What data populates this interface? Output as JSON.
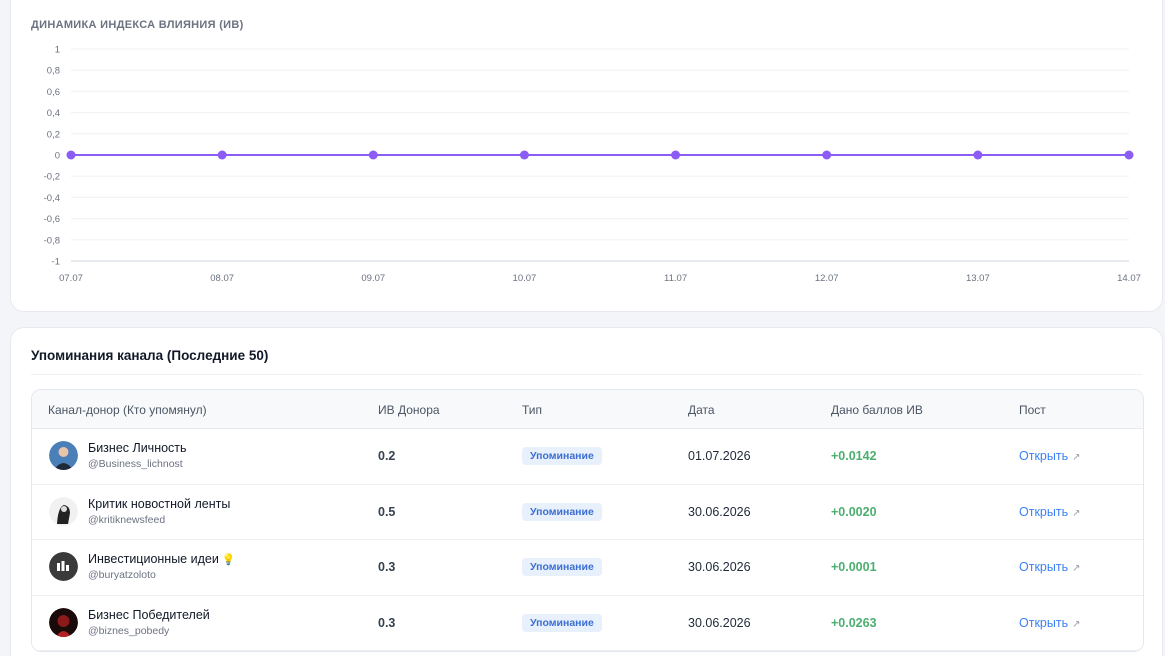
{
  "chart_card": {
    "title": "ДИНАМИКА ИНДЕКСА ВЛИЯНИЯ (ИВ)"
  },
  "chart_data": {
    "type": "line",
    "title": "ДИНАМИКА ИНДЕКСА ВЛИЯНИЯ (ИВ)",
    "categories": [
      "07.07",
      "08.07",
      "09.07",
      "10.07",
      "11.07",
      "12.07",
      "13.07",
      "14.07"
    ],
    "series": [
      {
        "values": [
          0,
          0,
          0,
          0,
          0,
          0,
          0,
          0
        ]
      }
    ],
    "yticks": [
      "1",
      "0,8",
      "0,6",
      "0,4",
      "0,2",
      "0",
      "-0,2",
      "-0,4",
      "-0,6",
      "-0,8",
      "-1"
    ],
    "ylim": [
      -1,
      1
    ],
    "grid": true,
    "line_color": "#8b5cf6"
  },
  "mentions": {
    "title": "Упоминания канала (Последние 50)",
    "columns": [
      "Канал-донор (Кто упомянул)",
      "ИВ Донора",
      "Тип",
      "Дата",
      "Дано баллов ИВ",
      "Пост"
    ],
    "rows": [
      {
        "name": "Бизнес Личность",
        "handle": "@Business_lichnost",
        "iv": "0.2",
        "type": "Упоминание",
        "date": "01.07.2026",
        "score": "+0.0142",
        "post": "Открыть",
        "avatar_color": "#4a7fb8"
      },
      {
        "name": "Критик новостной ленты",
        "handle": "@kritiknewsfeed",
        "iv": "0.5",
        "type": "Упоминание",
        "date": "30.06.2026",
        "score": "+0.0020",
        "post": "Открыть",
        "avatar_color": "#2b2b2b"
      },
      {
        "name": "Инвестиционные идеи",
        "handle": "@buryatzoloto",
        "iv": "0.3",
        "type": "Упоминание",
        "date": "30.06.2026",
        "score": "+0.0001",
        "post": "Открыть",
        "avatar_color": "#3a3a3a",
        "emoji": "💡"
      },
      {
        "name": "Бизнес Победителей",
        "handle": "@biznes_pobedy",
        "iv": "0.3",
        "type": "Упоминание",
        "date": "30.06.2026",
        "score": "+0.0263",
        "post": "Открыть",
        "avatar_color": "#5a1010"
      }
    ]
  }
}
